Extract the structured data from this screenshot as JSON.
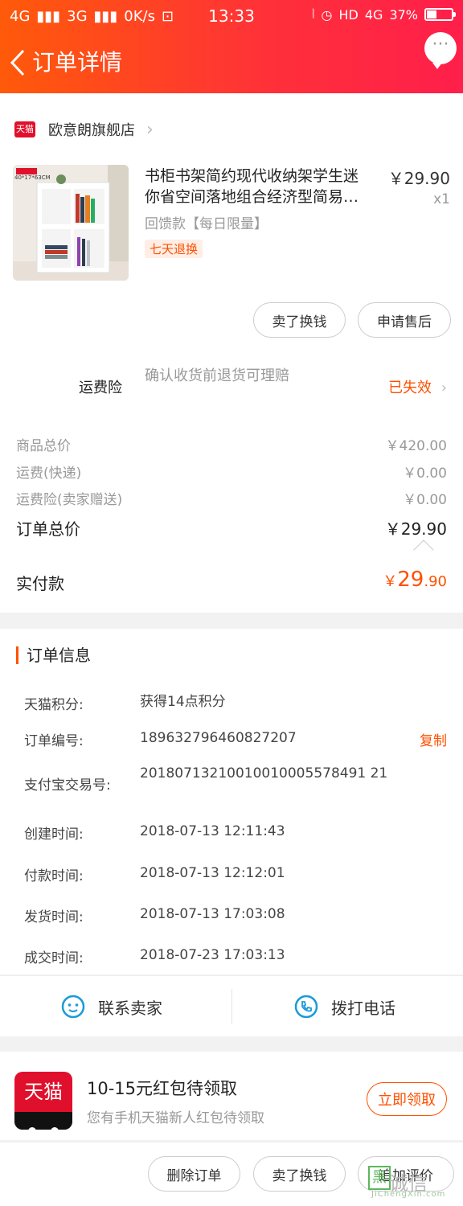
{
  "status_bar": {
    "network_left": "4G",
    "network_3g": "3G",
    "speed": "0K/s",
    "time": "13:33",
    "hd": "HD",
    "network_right": "4G",
    "battery": "37%",
    "battery_level": 0.37
  },
  "header": {
    "title": "订单详情",
    "more": "···"
  },
  "store": {
    "badge": "天猫",
    "name": "欧意朗旗舰店"
  },
  "product": {
    "thumb_tag": "40*17*63CM",
    "title_line1": "书柜书架简约现代收纳架学生迷",
    "title_line2": "你省空间落地组合经济型简易…",
    "price": "￥29.90",
    "qty": "x1",
    "sku": "回馈款【每日限量】",
    "tag": "七天退换"
  },
  "actions": {
    "sell": "卖了换钱",
    "after_sale": "申请售后"
  },
  "insurance": {
    "label": "运费险",
    "desc": "确认收货前退货可理赔",
    "status": "已失效"
  },
  "summary": {
    "items": [
      {
        "label": "商品总价",
        "value": "￥420.00"
      },
      {
        "label": "运费(快递)",
        "value": "￥0.00"
      },
      {
        "label": "运费险(卖家赠送)",
        "value": "￥0.00"
      }
    ],
    "total_label": "订单总价",
    "total_value": "￥29.90",
    "paid_label": "实付款",
    "paid_symbol": "￥",
    "paid_int": "29",
    "paid_dec": ".90"
  },
  "order_info": {
    "title": "订单信息",
    "rows": [
      {
        "label": "天猫积分:",
        "value": "获得14点积分"
      },
      {
        "label": "订单编号:",
        "value": "189632796460827207"
      },
      {
        "label": "支付宝交易号:",
        "value": "20180713210010010005578491 21"
      },
      {
        "label": "创建时间:",
        "value": "2018-07-13 12:11:43"
      },
      {
        "label": "付款时间:",
        "value": "2018-07-13 12:12:01"
      },
      {
        "label": "发货时间:",
        "value": "2018-07-13 17:03:08"
      },
      {
        "label": "成交时间:",
        "value": "2018-07-23 17:03:13"
      }
    ],
    "copy": "复制"
  },
  "contact": {
    "seller": "联系卖家",
    "phone": "拨打电话"
  },
  "promo": {
    "logo": "天猫",
    "title": "10-15元红包待领取",
    "subtitle": "您有手机天猫新人红包待领取",
    "button": "立即领取"
  },
  "bottom": {
    "delete": "删除订单",
    "sell": "卖了换钱",
    "review": "追加评价"
  },
  "watermark": {
    "mark": "黑",
    "text": "诚信",
    "url": "JiChengXin.com"
  },
  "colors": {
    "accent": "#ff5000",
    "header_start": "#ff5a0a",
    "header_end": "#ff1f4b",
    "tmall_red": "#e0102c"
  }
}
